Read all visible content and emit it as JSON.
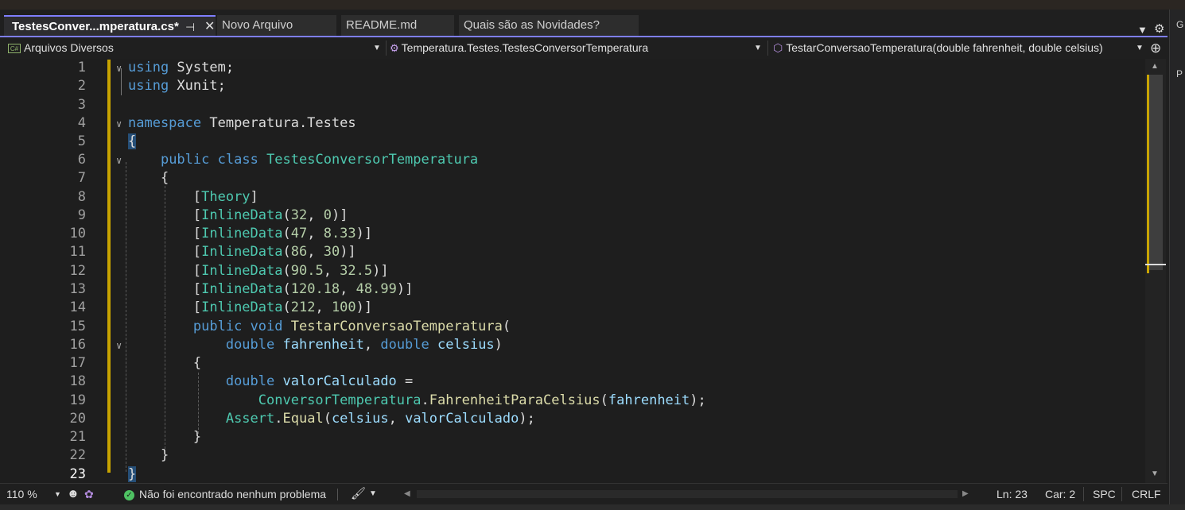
{
  "tabs": [
    {
      "label": "TestesConver...mperatura.cs*",
      "active": true
    },
    {
      "label": "Novo Arquivo",
      "active": false
    },
    {
      "label": "README.md",
      "active": false
    },
    {
      "label": "Quais são as Novidades?",
      "active": false
    }
  ],
  "tab_pin_icon": "pin-icon",
  "tab_close_icon": "close-icon",
  "navbar": {
    "project": "Arquivos Diversos",
    "type": "Temperatura.Testes.TestesConversorTemperatura",
    "member": "TestarConversaoTemperatura(double fahrenheit, double celsius)"
  },
  "editor": {
    "current_line": 23,
    "lines": [
      {
        "n": "1"
      },
      {
        "n": "2"
      },
      {
        "n": "3"
      },
      {
        "n": "4"
      },
      {
        "n": "5"
      },
      {
        "n": "6"
      },
      {
        "n": "7"
      },
      {
        "n": "8"
      },
      {
        "n": "9"
      },
      {
        "n": "10"
      },
      {
        "n": "11"
      },
      {
        "n": "12"
      },
      {
        "n": "13"
      },
      {
        "n": "14"
      },
      {
        "n": "15"
      },
      {
        "n": "16"
      },
      {
        "n": "17"
      },
      {
        "n": "18"
      },
      {
        "n": "19"
      },
      {
        "n": "20"
      },
      {
        "n": "21"
      },
      {
        "n": "22"
      },
      {
        "n": "23"
      }
    ]
  },
  "status": {
    "zoom": "110 %",
    "issues": "Não foi encontrado nenhum problema",
    "line": "Ln: 23",
    "column": "Car: 2",
    "indent": "SPC",
    "eol": "CRLF"
  },
  "colors": {
    "accent": "#7e7eff",
    "change_bar": "#c8a400",
    "ok": "#4ec262"
  }
}
